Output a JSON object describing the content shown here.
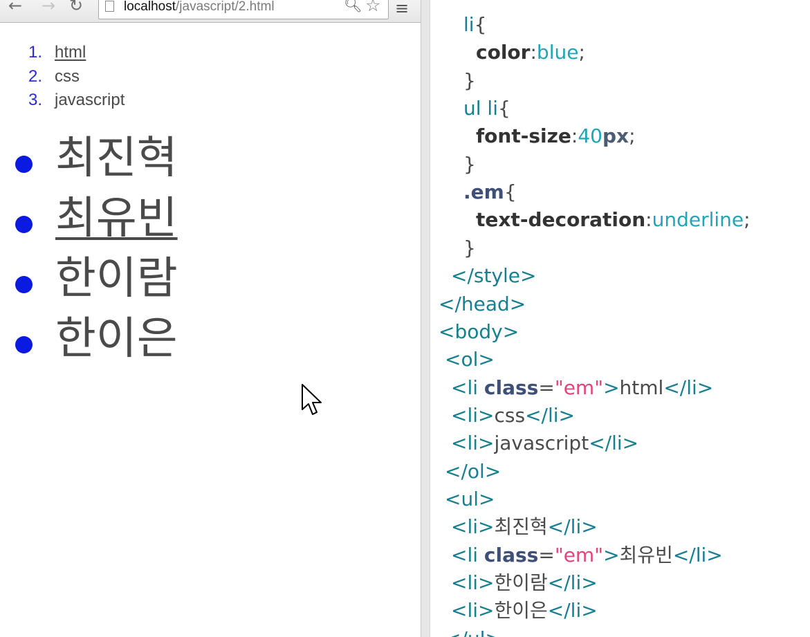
{
  "browser": {
    "url_host": "localhost",
    "url_path": "/javascript/2.html",
    "icons": {
      "back": "back-arrow-icon",
      "forward": "forward-arrow-icon",
      "reload": "reload-icon",
      "page": "page-icon",
      "zoom": "zoom-icon",
      "bookmark": "star-icon",
      "menu": "menu-icon"
    },
    "ordered_list": [
      {
        "number": "1.",
        "text": "html",
        "emphasized": true
      },
      {
        "number": "2.",
        "text": "css",
        "emphasized": false
      },
      {
        "number": "3.",
        "text": "javascript",
        "emphasized": false
      }
    ],
    "unordered_list": [
      {
        "text": "최진혁",
        "emphasized": false
      },
      {
        "text": "최유빈",
        "emphasized": true
      },
      {
        "text": "한이람",
        "emphasized": false
      },
      {
        "text": "한이은",
        "emphasized": false
      }
    ],
    "colors": {
      "list_text": "#0a1ae0",
      "link": "#2b2bd9"
    }
  },
  "editor": {
    "lines": [
      {
        "indent": "    ",
        "parts": [
          {
            "c": "sel",
            "t": "li"
          },
          {
            "c": "txt",
            "t": "{"
          }
        ]
      },
      {
        "indent": "      ",
        "parts": [
          {
            "c": "prop",
            "t": "color"
          },
          {
            "c": "txt",
            "t": ":"
          },
          {
            "c": "val",
            "t": "blue"
          },
          {
            "c": "txt",
            "t": ";"
          }
        ]
      },
      {
        "indent": "    ",
        "parts": [
          {
            "c": "txt",
            "t": "}"
          }
        ]
      },
      {
        "indent": "    ",
        "parts": [
          {
            "c": "sel",
            "t": "ul li"
          },
          {
            "c": "txt",
            "t": "{"
          }
        ]
      },
      {
        "indent": "      ",
        "parts": [
          {
            "c": "prop",
            "t": "font-size"
          },
          {
            "c": "txt",
            "t": ":"
          },
          {
            "c": "val",
            "t": "40"
          },
          {
            "c": "unit",
            "t": "px"
          },
          {
            "c": "txt",
            "t": ";"
          }
        ]
      },
      {
        "indent": "    ",
        "parts": [
          {
            "c": "txt",
            "t": "}"
          }
        ]
      },
      {
        "indent": "    ",
        "parts": [
          {
            "c": "cls",
            "t": ".em"
          },
          {
            "c": "txt",
            "t": "{"
          }
        ]
      },
      {
        "indent": "      ",
        "parts": [
          {
            "c": "prop",
            "t": "text-decoration"
          },
          {
            "c": "txt",
            "t": ":"
          },
          {
            "c": "val",
            "t": "underline"
          },
          {
            "c": "txt",
            "t": ";"
          }
        ]
      },
      {
        "indent": "    ",
        "parts": [
          {
            "c": "txt",
            "t": "}"
          }
        ]
      },
      {
        "indent": "  ",
        "parts": [
          {
            "c": "tag",
            "t": "</style>"
          }
        ]
      },
      {
        "indent": "",
        "parts": [
          {
            "c": "tag",
            "t": "</head>"
          }
        ]
      },
      {
        "indent": "",
        "parts": [
          {
            "c": "tag",
            "t": "<body>"
          }
        ]
      },
      {
        "indent": " ",
        "parts": [
          {
            "c": "tag",
            "t": "<ol>"
          }
        ]
      },
      {
        "indent": "  ",
        "parts": [
          {
            "c": "tag",
            "t": "<li "
          },
          {
            "c": "attr",
            "t": "class"
          },
          {
            "c": "txt",
            "t": "="
          },
          {
            "c": "str",
            "t": "\"em\""
          },
          {
            "c": "tag",
            "t": ">"
          },
          {
            "c": "txt",
            "t": "html"
          },
          {
            "c": "tag",
            "t": "</li>"
          }
        ]
      },
      {
        "indent": "  ",
        "parts": [
          {
            "c": "tag",
            "t": "<li>"
          },
          {
            "c": "txt",
            "t": "css"
          },
          {
            "c": "tag",
            "t": "</li>"
          }
        ]
      },
      {
        "indent": "  ",
        "parts": [
          {
            "c": "tag",
            "t": "<li>"
          },
          {
            "c": "txt",
            "t": "javascript"
          },
          {
            "c": "tag",
            "t": "</li>"
          }
        ]
      },
      {
        "indent": " ",
        "parts": [
          {
            "c": "tag",
            "t": "</ol>"
          }
        ]
      },
      {
        "indent": " ",
        "parts": [
          {
            "c": "tag",
            "t": "<ul>"
          }
        ]
      },
      {
        "indent": "  ",
        "parts": [
          {
            "c": "tag",
            "t": "<li>"
          },
          {
            "c": "txt",
            "t": "최진혁"
          },
          {
            "c": "tag",
            "t": "</li>"
          }
        ]
      },
      {
        "indent": "  ",
        "parts": [
          {
            "c": "tag",
            "t": "<li "
          },
          {
            "c": "attr",
            "t": "class"
          },
          {
            "c": "txt",
            "t": "="
          },
          {
            "c": "str",
            "t": "\"em\""
          },
          {
            "c": "tag",
            "t": ">"
          },
          {
            "c": "txt",
            "t": "최유빈"
          },
          {
            "c": "tag",
            "t": "</li>"
          }
        ]
      },
      {
        "indent": "  ",
        "parts": [
          {
            "c": "tag",
            "t": "<li>"
          },
          {
            "c": "txt",
            "t": "한이람"
          },
          {
            "c": "tag",
            "t": "</li>"
          }
        ]
      },
      {
        "indent": "  ",
        "parts": [
          {
            "c": "tag",
            "t": "<li>"
          },
          {
            "c": "txt",
            "t": "한이은"
          },
          {
            "c": "tag",
            "t": "</li>"
          }
        ]
      },
      {
        "indent": " ",
        "parts": [
          {
            "c": "tag",
            "t": "</ul>"
          }
        ]
      }
    ]
  }
}
